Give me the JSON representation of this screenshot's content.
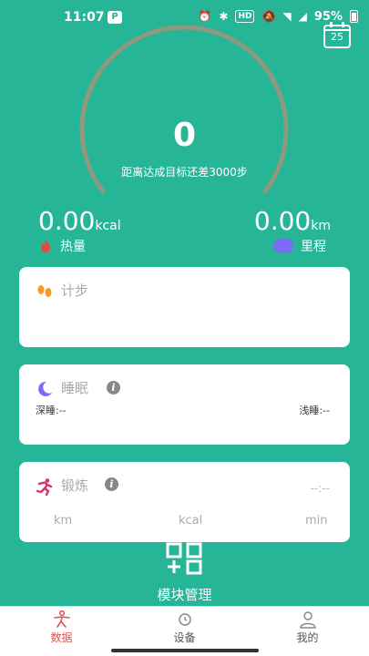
{
  "status_bar": {
    "time": "11:07",
    "hd": "HD",
    "battery": "95%"
  },
  "calendar": {
    "day": "25"
  },
  "steps": {
    "count": "0",
    "goal_text": "距离达成目标还差3000步",
    "progress": 0
  },
  "stats": {
    "calories": {
      "value": "0.00",
      "unit": "kcal",
      "label": "热量"
    },
    "distance": {
      "value": "0.00",
      "unit": "km",
      "label": "里程"
    }
  },
  "cards": {
    "steps": {
      "title": "计步"
    },
    "sleep": {
      "title": "睡眠",
      "deep_label": "深睡:--",
      "light_label": "浅睡:--"
    },
    "exercise": {
      "title": "锻炼",
      "time": "--:--",
      "units": [
        "km",
        "kcal",
        "min"
      ]
    }
  },
  "module_manage": {
    "label": "模块管理"
  },
  "nav": [
    {
      "label": "数据",
      "active": true
    },
    {
      "label": "设备",
      "active": false
    },
    {
      "label": "我的",
      "active": false
    }
  ],
  "colors": {
    "background": "#26b597",
    "accent_purple": "#7b6cf6",
    "active_red": "#d9534f"
  }
}
